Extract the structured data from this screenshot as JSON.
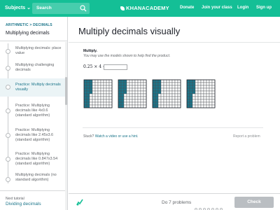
{
  "header": {
    "subjects_label": "Subjects",
    "search_placeholder": "Search",
    "logo_text": "KHANACADEMY",
    "nav": {
      "donate": "Donate",
      "join_class": "Join your class",
      "login": "Login",
      "signup": "Sign up"
    }
  },
  "sidebar": {
    "breadcrumb": "ARITHMETIC > DECIMALS",
    "title": "Multiplying decimals",
    "items": [
      {
        "label": "Multiplying decimals: place value",
        "selected": false
      },
      {
        "label": "Multiplying challenging decimals",
        "selected": false
      },
      {
        "label": "Practice: Multiply decimals visually",
        "selected": true
      },
      {
        "label": "Practice: Multiplying decimals like 4x0.6 (standard algorithm)",
        "selected": false
      },
      {
        "label": "Practice: Multiplying decimals like 2.45x3.6 (standard algorithm)",
        "selected": false
      },
      {
        "label": "Practice: Multiplying decimals like 0.847x3.54 (standard algorithm)",
        "selected": false
      },
      {
        "label": "Multiplying decimals (no standard algorithm)",
        "selected": false
      }
    ],
    "next_label": "Next tutorial",
    "next_link": "Dividing decimals"
  },
  "main": {
    "title": "Multiply decimals visually",
    "question_label": "Multiply.",
    "instruction": "You may use the models shown to help find the product.",
    "expression": "0.25 × 4 =",
    "answer_value": "",
    "models": {
      "count": 4,
      "shaded_per_model": 25,
      "grid_size": 10,
      "shade_color": "#1c758a"
    },
    "stuck_prefix": "Stuck?",
    "stuck_link": "Watch a video or use a hint.",
    "report": "Report a problem"
  },
  "footer": {
    "do_problems": "Do 7 problems",
    "progress_total": 7,
    "check_label": "Check"
  },
  "colors": {
    "brand": "#14bf96",
    "link": "#1c758a",
    "check_disabled": "#babec2"
  }
}
